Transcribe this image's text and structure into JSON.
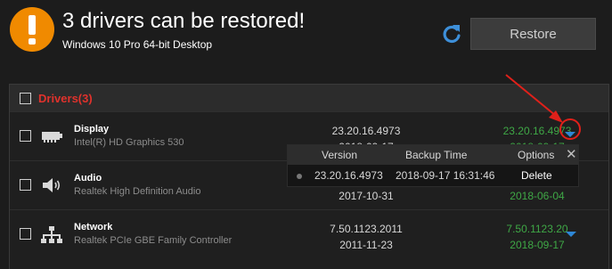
{
  "header": {
    "title": "3 drivers can be restored!",
    "subtitle": "Windows 10 Pro 64-bit Desktop",
    "restore_label": "Restore",
    "warning_icon": "warning-icon",
    "refresh_icon": "refresh-icon"
  },
  "panel": {
    "title": "Drivers(3)"
  },
  "drivers": [
    {
      "name": "Display",
      "description": "Intel(R) HD Graphics 530",
      "current_version": "23.20.16.4973",
      "current_date": "2018-09-17",
      "backup_version": "23.20.16.4973",
      "backup_date": "2018-09-17",
      "icon": "display-card-icon"
    },
    {
      "name": "Audio",
      "description": "Realtek High Definition Audio",
      "current_version": "",
      "current_date": "2017-10-31",
      "backup_version": "",
      "backup_date": "2018-06-04",
      "icon": "speaker-icon"
    },
    {
      "name": "Network",
      "description": "Realtek PCIe GBE Family Controller",
      "current_version": "7.50.1123.2011",
      "current_date": "2011-11-23",
      "backup_version": "7.50.1123.20",
      "backup_date": "2018-09-17",
      "icon": "network-icon"
    }
  ],
  "popup": {
    "col_version": "Version",
    "col_backup_time": "Backup Time",
    "col_options": "Options",
    "entry_version": "23.20.16.4973",
    "entry_time": "2018-09-17 16:31:46",
    "entry_action": "Delete"
  },
  "colors": {
    "accent_orange": "#f08a00",
    "title_red": "#e0322c",
    "backup_green": "#3fa846",
    "dropdown_blue": "#2e87d6",
    "annotation_red": "#e0201a"
  }
}
